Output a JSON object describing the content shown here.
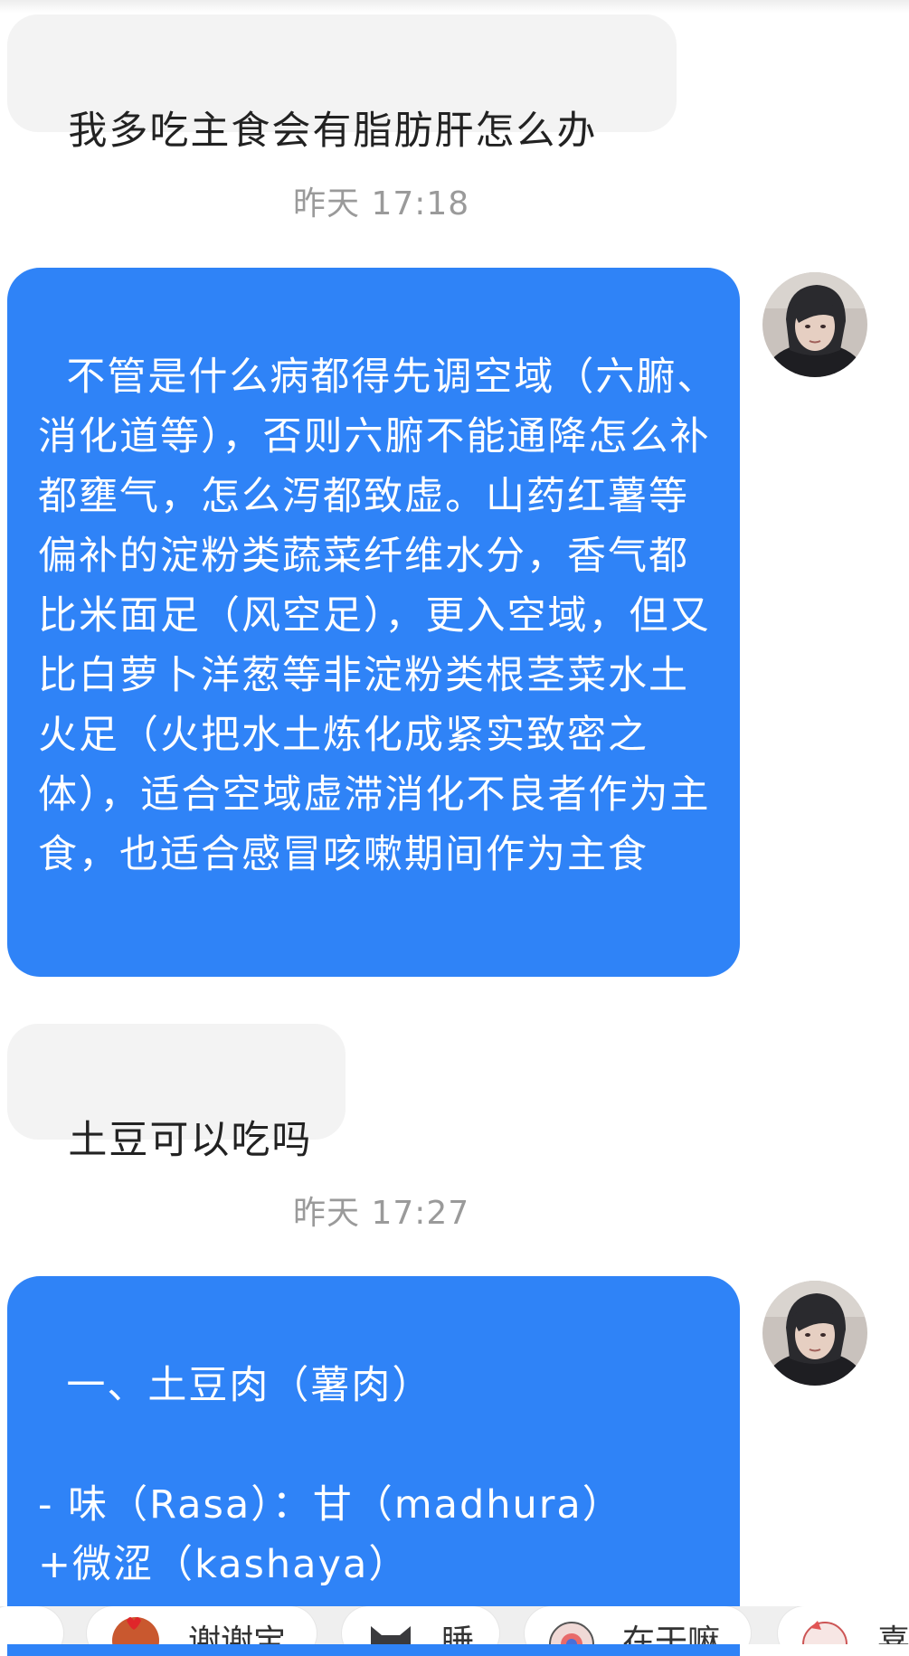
{
  "conversation": {
    "messages": [
      {
        "type": "incoming",
        "text": "我多吃主食会有脂肪肝怎么办"
      },
      {
        "type": "timestamp",
        "text": "昨天 17:18"
      },
      {
        "type": "outgoing",
        "text": "不管是什么病都得先调空域（六腑、消化道等），否则六腑不能通降怎么补都壅气，怎么泻都致虚。山药红薯等偏补的淀粉类蔬菜纤维水分，香气都比米面足（风空足），更入空域，但又比白萝卜洋葱等非淀粉类根茎菜水土火足（火把水土炼化成紧实致密之体），适合空域虚滞消化不良者作为主食，也适合感冒咳嗽期间作为主食"
      },
      {
        "type": "incoming",
        "text": "土豆可以吃吗"
      },
      {
        "type": "timestamp",
        "text": "昨天 17:27"
      },
      {
        "type": "outgoing",
        "text": "一、土豆肉（薯肉）\n\n- 味（Rasa）：甘（madhura）\n+微涩（kashaya）"
      }
    ]
  },
  "quick_replies": [
    {
      "label": "…",
      "icon": "partial-chip-icon"
    },
    {
      "label": "谢谢宝",
      "icon": "heart-face-icon"
    },
    {
      "label": "睡",
      "icon": "cat-icon"
    },
    {
      "label": "在干嘛",
      "icon": "doll-icon"
    },
    {
      "label": "喜",
      "icon": "pig-face-icon"
    }
  ],
  "colors": {
    "outgoing_bubble": "#2f83f7",
    "incoming_bubble": "#f3f3f3",
    "timestamp_text": "#9a9a9a"
  }
}
